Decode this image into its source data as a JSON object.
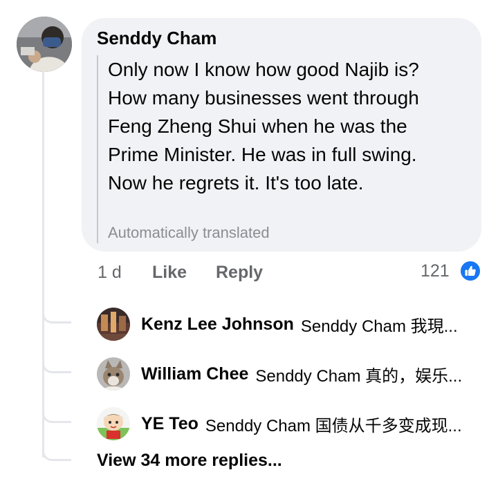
{
  "comment": {
    "author": "Senddy Cham",
    "text": "Only now I know how good Najib is?\nHow many businesses went through\nFeng Zheng Shui when he was the\nPrime Minister. He was in full swing.\nNow he regrets it. It's too late.",
    "translation_note": "Automatically translated",
    "time": "1 d",
    "like_label": "Like",
    "reply_label": "Reply",
    "reaction_count": "121",
    "reaction_icon": "thumbs-up-icon",
    "accent_color": "#1877f2"
  },
  "replies": [
    {
      "name": "Kenz Lee Johnson",
      "preview": "Senddy Cham 我現..."
    },
    {
      "name": "William Chee",
      "preview": "Senddy Cham 真的，娱乐..."
    },
    {
      "name": "YE Teo",
      "preview": "Senddy Cham 国债从千多变成现..."
    }
  ],
  "view_more_label": "View 34 more replies..."
}
